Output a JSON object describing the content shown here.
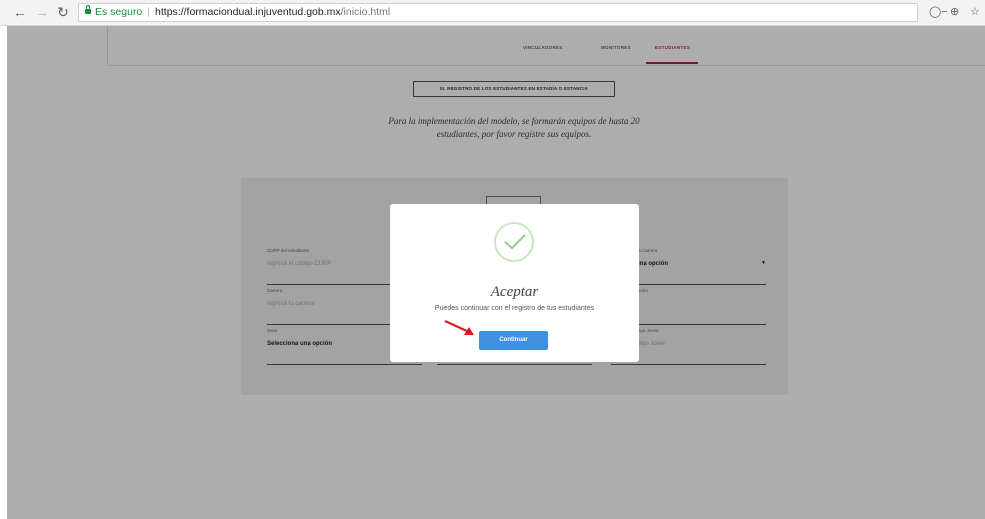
{
  "browser": {
    "secure_label": "Es seguro",
    "url_scheme_host": "https://formaciondual.injuventud.gob.mx",
    "url_path": "/inicio.html",
    "back_icon": "arrow-left-icon",
    "forward_icon": "arrow-right-icon",
    "reload_icon": "reload-icon"
  },
  "nav": {
    "items": [
      {
        "label": "VINCULADORES"
      },
      {
        "label": "MONITORES"
      },
      {
        "label": "ESTUDIANTES"
      }
    ],
    "active_color": "#c0264a"
  },
  "section": {
    "title": "III. REGISTRO DE LOS ESTUDIANTES EN ESTADÍA O ESTANCIA",
    "intro_line1": "Para la implementación del modelo, se formarán equipos de hasta 20",
    "intro_line2": "estudiantes, por favor registre sus equipos."
  },
  "form": {
    "curp_label": "CURP del estudiante",
    "curp_placeholder": "Ingresa el código CURP",
    "carrera_label": "Carrera",
    "carrera_placeholder": "Ingresa tu carrera",
    "sexo_label": "Sexo",
    "sexo_value": "Selecciona una opción",
    "right1_label": "de la Carrera",
    "right1_value": "a una opción",
    "right2_label": "pimiento",
    "right3_label": "Código Joven",
    "right3_placeholder": "código Joven"
  },
  "modal": {
    "title": "Aceptar",
    "message": "Puedes continuar con el registro de tus estudiantes",
    "button_label": "Continuar",
    "accent_color": "#3f8fe2",
    "success_icon": "checkmark-icon"
  }
}
